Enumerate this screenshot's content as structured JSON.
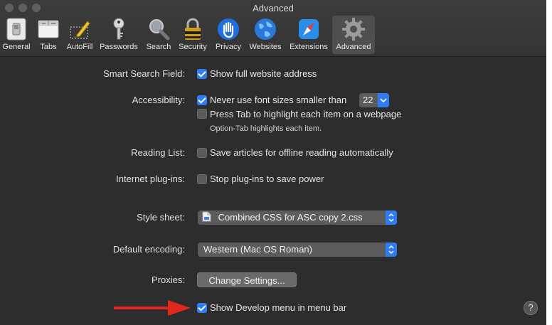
{
  "window": {
    "title": "Advanced"
  },
  "toolbar": {
    "items": [
      {
        "label": "General",
        "icon": "general-switch-icon"
      },
      {
        "label": "Tabs",
        "icon": "tabs-icon"
      },
      {
        "label": "AutoFill",
        "icon": "autofill-pencil-icon"
      },
      {
        "label": "Passwords",
        "icon": "key-icon"
      },
      {
        "label": "Search",
        "icon": "magnifier-icon"
      },
      {
        "label": "Security",
        "icon": "padlock-icon"
      },
      {
        "label": "Privacy",
        "icon": "hand-icon"
      },
      {
        "label": "Websites",
        "icon": "globe-icon"
      },
      {
        "label": "Extensions",
        "icon": "compass-icon"
      },
      {
        "label": "Advanced",
        "icon": "gear-icon"
      }
    ],
    "selected": "Advanced"
  },
  "settings": {
    "smart_search": {
      "label": "Smart Search Field:",
      "option": "Show full website address",
      "checked": true
    },
    "accessibility": {
      "label": "Accessibility:",
      "font_option": "Never use font sizes smaller than",
      "font_checked": true,
      "font_size": "22",
      "tab_option": "Press Tab to highlight each item on a webpage",
      "tab_checked": false,
      "tab_hint": "Option-Tab highlights each item."
    },
    "reading_list": {
      "label": "Reading List:",
      "option": "Save articles for offline reading automatically",
      "checked": false
    },
    "plugins": {
      "label": "Internet plug-ins:",
      "option": "Stop plug-ins to save power",
      "checked": false
    },
    "style_sheet": {
      "label": "Style sheet:",
      "value": "Combined CSS for ASC copy 2.css",
      "file_icon": "css-file-icon"
    },
    "encoding": {
      "label": "Default encoding:",
      "value": "Western (Mac OS Roman)"
    },
    "proxies": {
      "label": "Proxies:",
      "button": "Change Settings..."
    },
    "develop": {
      "option": "Show Develop menu in menu bar",
      "checked": true
    }
  },
  "help": {
    "label": "?"
  },
  "colors": {
    "accent": "#2e7cf6",
    "background": "#2d2d2d",
    "annotation_arrow": "#e0281e"
  }
}
